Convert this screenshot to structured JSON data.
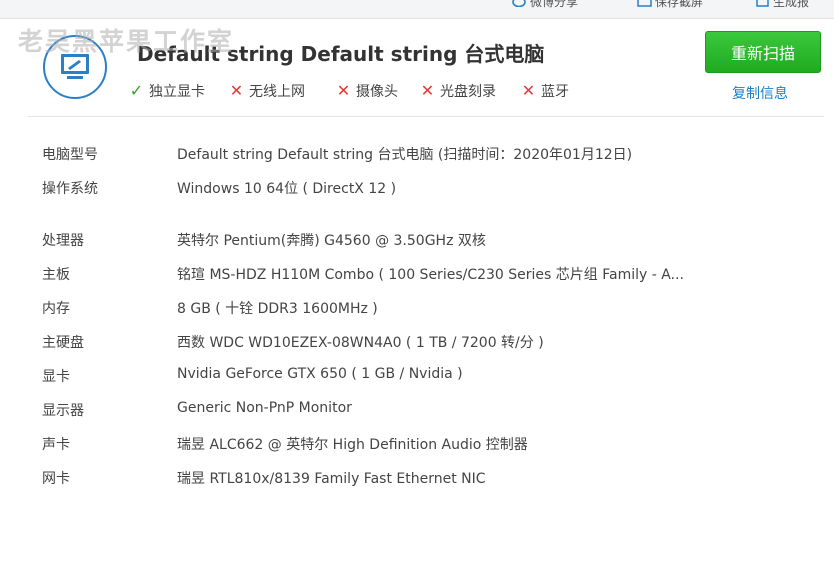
{
  "topbar": {
    "actions": [
      {
        "label": "微博分享",
        "icon": "weibo-icon"
      },
      {
        "label": "保存截屏",
        "icon": "screenshot-icon"
      },
      {
        "label": "生成报",
        "icon": "report-icon"
      }
    ]
  },
  "watermark": "老吴黑苹果工作室",
  "header": {
    "device_title": "Default string Default string 台式电脑",
    "features": [
      {
        "label": "独立显卡",
        "present": true
      },
      {
        "label": "无线上网",
        "present": false
      },
      {
        "label": "摄像头",
        "present": false
      },
      {
        "label": "光盘刻录",
        "present": false
      },
      {
        "label": "蓝牙",
        "present": false
      }
    ],
    "rescan_label": "重新扫描",
    "copy_label": "复制信息"
  },
  "specs": [
    {
      "key": "电脑型号",
      "value": "Default string Default string 台式电脑  (扫描时间：2020年01月12日)"
    },
    {
      "key": "操作系统",
      "value": "Windows 10 64位 ( DirectX 12 )"
    },
    {
      "key": "处理器",
      "value": "英特尔 Pentium(奔腾) G4560 @ 3.50GHz 双核"
    },
    {
      "key": "主板",
      "value": "铭瑄 MS-HDZ H110M Combo ( 100 Series/C230 Series 芯片组 Family - A..."
    },
    {
      "key": "内存",
      "value": "8 GB ( 十铨 DDR3 1600MHz )"
    },
    {
      "key": "主硬盘",
      "value": "西数 WDC WD10EZEX-08WN4A0 ( 1 TB / 7200 转/分 )"
    },
    {
      "key": "显卡",
      "value": "Nvidia GeForce GTX 650 ( 1 GB / Nvidia )"
    },
    {
      "key": "显示器",
      "value": "Generic Non-PnP Monitor"
    },
    {
      "key": "声卡",
      "value": "瑞昱 ALC662 @ 英特尔 High Definition Audio 控制器"
    },
    {
      "key": "网卡",
      "value": "瑞昱 RTL810x/8139 Family Fast Ethernet NIC"
    }
  ],
  "colors": {
    "accent_blue": "#2b7fc7",
    "button_green": "#2bb52b",
    "check_green": "#2da32d",
    "cross_red": "#e23b3b",
    "link_blue": "#1d7ec6"
  }
}
